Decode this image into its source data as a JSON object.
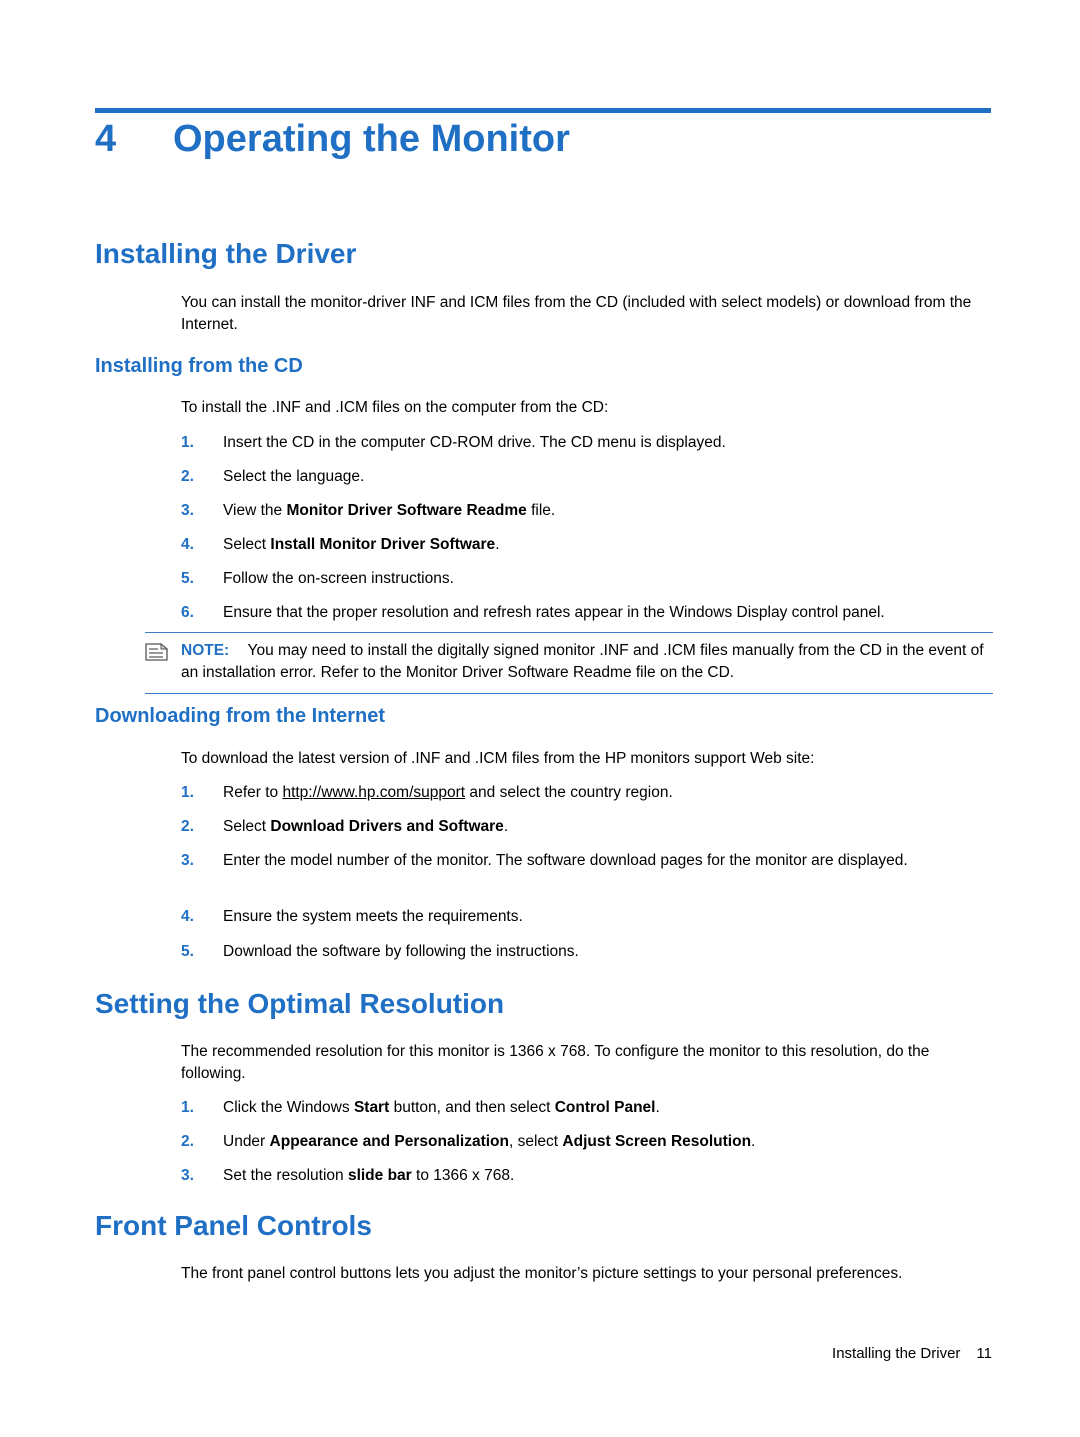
{
  "chapter": {
    "number": "4",
    "title": "Operating the Monitor"
  },
  "sections": {
    "installing_driver": {
      "heading": "Installing the Driver",
      "intro": "You can install the monitor-driver INF and ICM files from the CD (included with select models) or download from the Internet."
    },
    "installing_cd": {
      "heading": "Installing from the CD",
      "intro": "To install the .INF and .ICM files on the computer from the CD:",
      "steps": [
        {
          "num": "1.",
          "text": "Insert the CD in the computer CD-ROM drive. The CD menu is displayed."
        },
        {
          "num": "2.",
          "text": "Select the language."
        },
        {
          "num": "3.",
          "text": "View the Monitor Driver Software Readme file."
        },
        {
          "num": "4.",
          "text": "Select Install Monitor Driver Software."
        },
        {
          "num": "5.",
          "text": "Follow the on-screen instructions."
        },
        {
          "num": "6.",
          "text": "Ensure that the proper resolution and refresh rates appear in the Windows Display control panel."
        }
      ]
    },
    "note": {
      "label": "NOTE:",
      "icon": "note-icon",
      "text": "You may need to install the digitally signed monitor .INF and .ICM files manually from the CD in the event of an installation error. Refer to the Monitor Driver Software Readme file on the CD."
    },
    "downloading_internet": {
      "heading": "Downloading from the Internet",
      "intro": "To download the latest version of .INF and .ICM files from the HP monitors support Web site:",
      "steps": [
        {
          "num": "1.",
          "text_before": "Refer to ",
          "link": "http://www.hp.com/support",
          "text_after": " and select the country region."
        },
        {
          "num": "2.",
          "text": "Select Download Drivers and Software."
        },
        {
          "num": "3.",
          "text": "Enter the model number of the monitor. The software download pages for the monitor are displayed."
        },
        {
          "num": "4.",
          "text": "Ensure the system meets the requirements."
        },
        {
          "num": "5.",
          "text": "Download the software by following the instructions."
        }
      ]
    },
    "optimal_resolution": {
      "heading": "Setting the Optimal Resolution",
      "intro": "The recommended resolution for this monitor is 1366 x 768. To configure the monitor to this resolution, do the following.",
      "steps": [
        {
          "num": "1.",
          "text": "Click the Windows Start button, and then select Control Panel."
        },
        {
          "num": "2.",
          "text": "Under Appearance and Personalization, select Adjust Screen Resolution."
        },
        {
          "num": "3.",
          "text": "Set the resolution slide bar to 1366 x 768."
        }
      ]
    },
    "front_panel": {
      "heading": "Front Panel Controls",
      "intro": "The front panel control buttons lets you adjust the monitor’s picture settings to your personal preferences."
    }
  },
  "footer": {
    "text": "Installing the Driver",
    "page": "11"
  },
  "colors": {
    "accent": "#1f6fc4",
    "text": "#000000"
  }
}
